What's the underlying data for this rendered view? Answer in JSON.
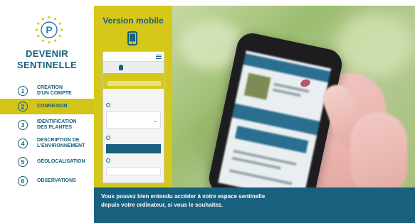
{
  "brand": {
    "line1": "DEVENIR",
    "line2": "SENTINELLE",
    "logo_icon": "p-logo-icon",
    "logo_color": "#2a77b0",
    "accent_color": "#d6c81b",
    "primary_color": "#17607e"
  },
  "steps": [
    {
      "num": "1",
      "label": "CRÉATION\nD'UN COMPTE",
      "active": false
    },
    {
      "num": "2",
      "label": "CONNEXION",
      "active": true
    },
    {
      "num": "3",
      "label": "IDENTIFICATION\nDES PLANTES",
      "active": false
    },
    {
      "num": "4",
      "label": "DESCRIPTION DE\nL'ENVIRONNEMENT",
      "active": false
    },
    {
      "num": "5",
      "label": "GÉOLOCALISATION",
      "active": false
    },
    {
      "num": "6",
      "label": "OBSERVATIONS",
      "active": false
    }
  ],
  "mobile": {
    "title": "Version mobile",
    "icon": "smartphone-icon"
  },
  "caption": {
    "line1": "Vous pouvez bien entendu accéder à votre espace sentinelle",
    "line2": "depuis votre ordinateur, si vous le souhaitez."
  }
}
